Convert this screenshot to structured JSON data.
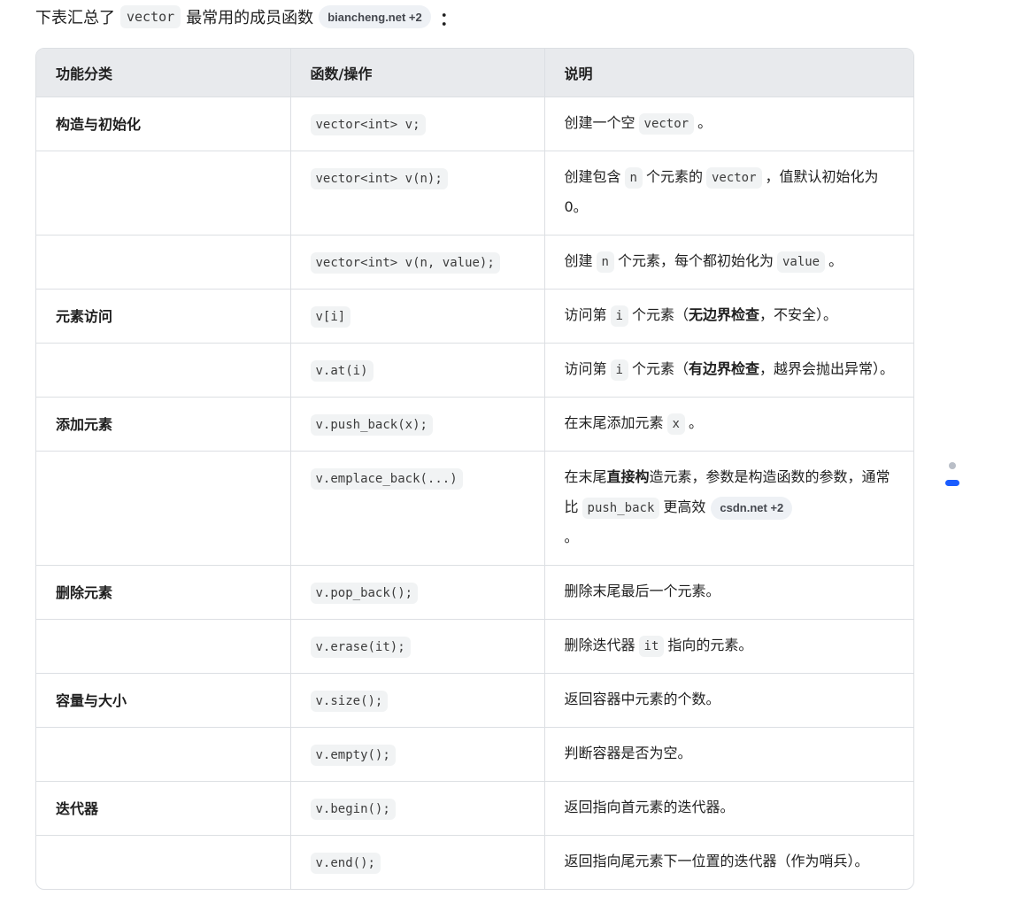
{
  "intro": {
    "before": "下表汇总了",
    "code": "vector",
    "after": "最常用的成员函数",
    "source_chip": "biancheng.net +2",
    "colon": "："
  },
  "table": {
    "headers": [
      "功能分类",
      "函数/操作",
      "说明"
    ],
    "rows": [
      {
        "category": "构造与初始化",
        "function": "vector<int> v;",
        "desc": {
          "t1": "创建一个空",
          "c1": "vector",
          "t2": "。"
        }
      },
      {
        "category": "",
        "function": "vector<int> v(n);",
        "desc": {
          "t1": "创建包含",
          "c1": "n",
          "t2": "个元素的",
          "c2": "vector",
          "t3": "，值默认初始化为0。"
        }
      },
      {
        "category": "",
        "function": "vector<int> v(n, value);",
        "desc": {
          "t1": "创建",
          "c1": "n",
          "t2": "个元素，每个都初始化为",
          "c2": "value",
          "t3": "。"
        }
      },
      {
        "category": "元素访问",
        "function": "v[i]",
        "desc": {
          "t1": "访问第",
          "c1": "i",
          "t2": "个元素（",
          "b1": "无边界检查",
          "t3": "，不安全）。"
        }
      },
      {
        "category": "",
        "function": "v.at(i)",
        "desc": {
          "t1": "访问第",
          "c1": "i",
          "t2": "个元素（",
          "b1": "有边界检查",
          "t3": "，越界会抛出异常）。"
        }
      },
      {
        "category": "添加元素",
        "function": "v.push_back(x);",
        "desc": {
          "t1": "在末尾添加元素",
          "c1": "x",
          "t2": "。"
        }
      },
      {
        "category": "",
        "function": "v.emplace_back(...)",
        "desc": {
          "t1": "在末尾",
          "b1": "直接构",
          "t2": "造元素，参数是构造函数的参数，通常比",
          "c1": "push_back",
          "t3": "更高效",
          "chip": "csdn.net +2",
          "t4": "。"
        }
      },
      {
        "category": "删除元素",
        "function": "v.pop_back();",
        "desc": {
          "t1": "删除末尾最后一个元素。"
        }
      },
      {
        "category": "",
        "function": "v.erase(it);",
        "desc": {
          "t1": "删除迭代器",
          "c1": "it",
          "t2": "指向的元素。"
        }
      },
      {
        "category": "容量与大小",
        "function": "v.size();",
        "desc": {
          "t1": "返回容器中元素的个数。"
        }
      },
      {
        "category": "",
        "function": "v.empty();",
        "desc": {
          "t1": "判断容器是否为空。"
        }
      },
      {
        "category": "迭代器",
        "function": "v.begin();",
        "desc": {
          "t1": "返回指向首元素的迭代器。"
        }
      },
      {
        "category": "",
        "function": "v.end();",
        "desc": {
          "t1": "返回指向尾元素下一位置的迭代器（作为哨兵）。"
        }
      }
    ]
  },
  "pager": {
    "pages": 2,
    "active": 2
  }
}
